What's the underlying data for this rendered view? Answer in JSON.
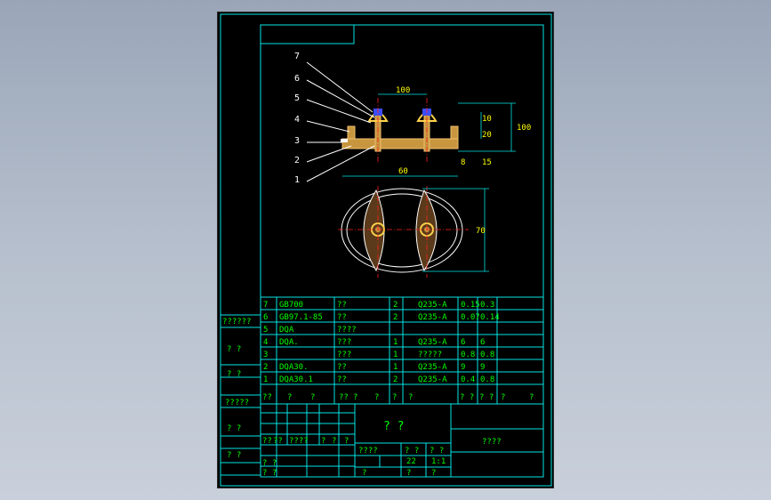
{
  "colors": {
    "frame": "#00e5e5",
    "text": "#00ff00",
    "part": "#d8a24a",
    "center": "#ff2020",
    "bolt": "#3b4dff"
  },
  "leaders": [
    "7",
    "6",
    "5",
    "4",
    "3",
    "2",
    "1"
  ],
  "dims": {
    "top_span": "100",
    "depth": "100",
    "plan_width": "60",
    "plan_height": "70",
    "h1": "10",
    "h2": "20",
    "h3": "8",
    "h4": "15"
  },
  "bom": [
    {
      "no": "7",
      "code": "GB700",
      "name": "??",
      "qty": "2",
      "mat": "Q235-A",
      "w1": "0.15",
      "w2": "0.3"
    },
    {
      "no": "6",
      "code": "GB97.1-85",
      "name": "??",
      "qty": "2",
      "mat": "Q235-A",
      "w1": "0.07",
      "w2": "0.14"
    },
    {
      "no": "5",
      "code": "DQA",
      "name": "????",
      "qty": "",
      "mat": "",
      "w1": "",
      "w2": ""
    },
    {
      "no": "4",
      "code": "DQA.",
      "name": "???",
      "qty": "1",
      "mat": "Q235-A",
      "w1": "6",
      "w2": "6"
    },
    {
      "no": "3",
      "code": "",
      "name": "???",
      "qty": "1",
      "mat": "?????",
      "w1": "0.8",
      "w2": "0.8"
    },
    {
      "no": "2",
      "code": "DQA30.",
      "name": "??",
      "qty": "1",
      "mat": "Q235-A",
      "w1": "9",
      "w2": "9"
    },
    {
      "no": "1",
      "code": "DQA30.1",
      "name": "??",
      "qty": "2",
      "mat": "Q235-A",
      "w1": "0.4",
      "w2": "0.8"
    }
  ],
  "bom_header": [
    "??",
    "?",
    "?",
    "??",
    "?",
    "?",
    "?",
    "?",
    "? ?",
    "? ?",
    "?",
    "?"
  ],
  "side": [
    "??????",
    "?  ?",
    "?  ?",
    "?????",
    "?  ?",
    "?  ?"
  ],
  "title": {
    "name": "?   ?",
    "drawing_no": "????",
    "scale": "22",
    "sheet": "1:1",
    "cells": [
      "??",
      "??",
      "????",
      "?",
      "?",
      "?",
      "? ?",
      "? ?",
      "????",
      "? ?",
      "? ?",
      "?",
      "?",
      "?"
    ]
  }
}
